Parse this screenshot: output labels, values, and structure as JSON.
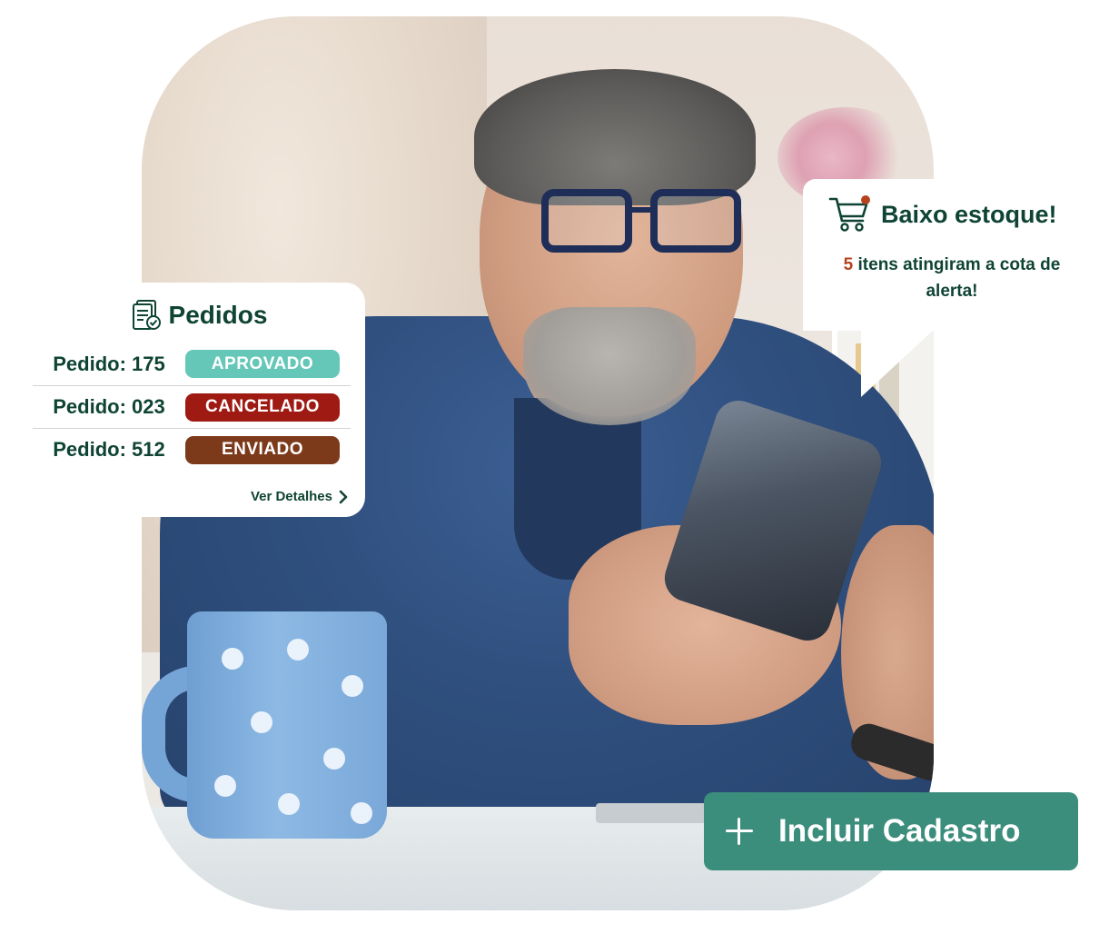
{
  "orders": {
    "title": "Pedidos",
    "icon": "document-check-icon",
    "rows": [
      {
        "label": "Pedido: 175",
        "status": "APROVADO",
        "color": "#64c7b7"
      },
      {
        "label": "Pedido: 023",
        "status": "CANCELADO",
        "color": "#9e1a12"
      },
      {
        "label": "Pedido: 512",
        "status": "ENVIADO",
        "color": "#7c3a1b"
      }
    ],
    "details_label": "Ver Detalhes",
    "details_icon": "chevron-right-icon"
  },
  "stock_alert": {
    "icon": "shopping-cart-icon",
    "title": "Baixo estoque!",
    "count": "5",
    "message": " itens atingiram a cota de alerta!",
    "accent": "#b5441e"
  },
  "cta": {
    "icon": "plus-icon",
    "label": "Incluir Cadastro",
    "color": "#3b8d7c"
  },
  "colors": {
    "text_dark": "#0f4434"
  }
}
